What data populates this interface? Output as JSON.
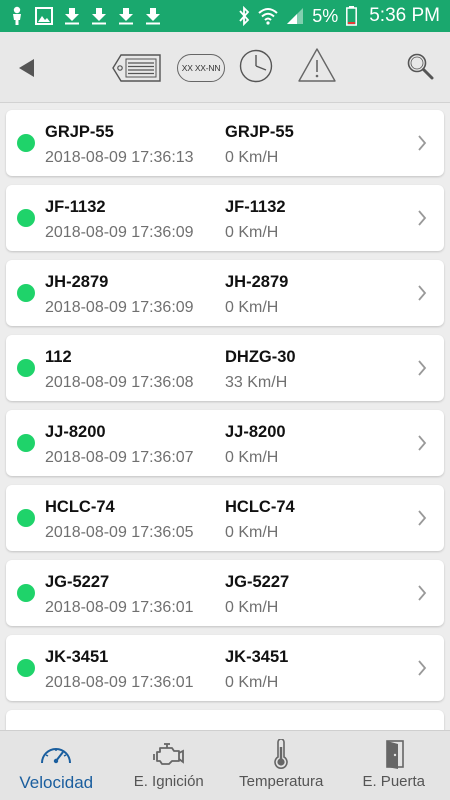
{
  "statusbar": {
    "battery": "5%",
    "time": "5:36 PM",
    "icons": [
      "person-icon",
      "image-icon",
      "download-icon",
      "download-icon",
      "download-icon",
      "download-icon",
      "bluetooth-icon",
      "wifi-icon",
      "signal-icon",
      "battery-icon"
    ]
  },
  "toolbar": {
    "plate_format_label": "XX XX-NN",
    "icons": [
      "back-arrow-icon",
      "tag-icon",
      "plate-format-icon",
      "clock-icon",
      "warning-icon",
      "search-icon"
    ]
  },
  "vehicles": [
    {
      "id": "GRJP-55",
      "plate": "GRJP-55",
      "timestamp": "2018-08-09 17:36:13",
      "speed": "0 Km/H",
      "status_color": "#1fd36a"
    },
    {
      "id": "JF-1132",
      "plate": "JF-1132",
      "timestamp": "2018-08-09 17:36:09",
      "speed": "0 Km/H",
      "status_color": "#1fd36a"
    },
    {
      "id": "JH-2879",
      "plate": "JH-2879",
      "timestamp": "2018-08-09 17:36:09",
      "speed": "0 Km/H",
      "status_color": "#1fd36a"
    },
    {
      "id": "112",
      "plate": "DHZG-30",
      "timestamp": "2018-08-09 17:36:08",
      "speed": "33 Km/H",
      "status_color": "#1fd36a"
    },
    {
      "id": "JJ-8200",
      "plate": "JJ-8200",
      "timestamp": "2018-08-09 17:36:07",
      "speed": "0 Km/H",
      "status_color": "#1fd36a"
    },
    {
      "id": "HCLC-74",
      "plate": "HCLC-74",
      "timestamp": "2018-08-09 17:36:05",
      "speed": "0 Km/H",
      "status_color": "#1fd36a"
    },
    {
      "id": "JG-5227",
      "plate": "JG-5227",
      "timestamp": "2018-08-09 17:36:01",
      "speed": "0 Km/H",
      "status_color": "#1fd36a"
    },
    {
      "id": "JK-3451",
      "plate": "JK-3451",
      "timestamp": "2018-08-09 17:36:01",
      "speed": "0 Km/H",
      "status_color": "#1fd36a"
    }
  ],
  "bottomnav": {
    "items": [
      {
        "label": "Velocidad",
        "icon": "speedometer-icon",
        "active": true
      },
      {
        "label": "E. Ignición",
        "icon": "engine-icon",
        "active": false
      },
      {
        "label": "Temperatura",
        "icon": "thermometer-icon",
        "active": false
      },
      {
        "label": "E. Puerta",
        "icon": "door-icon",
        "active": false
      }
    ]
  },
  "colors": {
    "statusbar": "#1aa86e",
    "status_dot": "#1fd36a",
    "active_nav": "#1a5e9e"
  }
}
